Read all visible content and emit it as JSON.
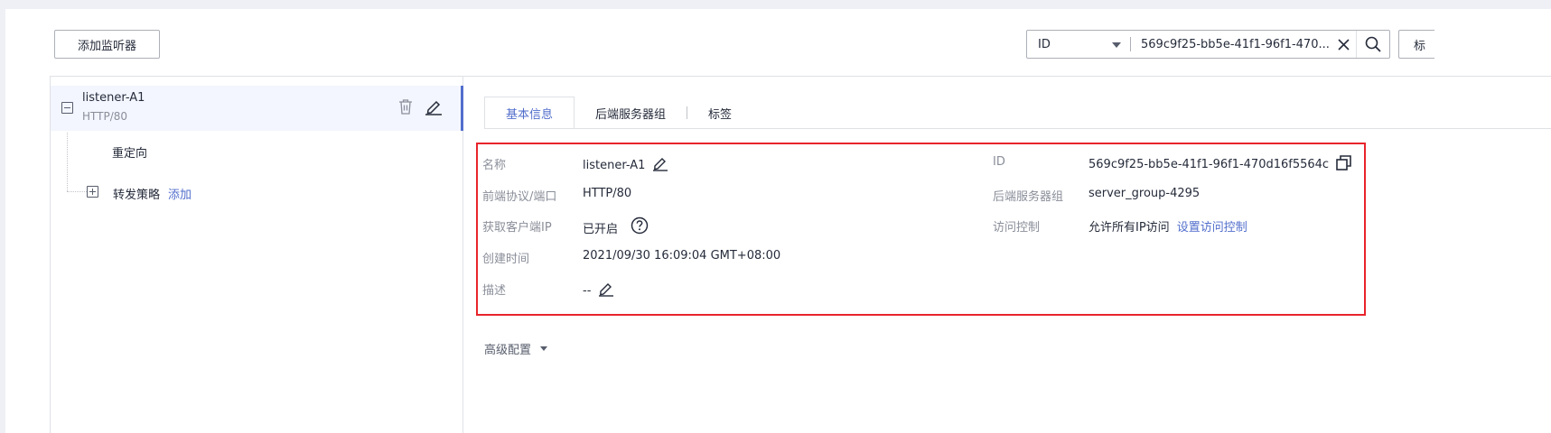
{
  "toolbar": {
    "add_listener_label": "添加监听器",
    "search": {
      "field": "ID",
      "value": "569c9f25-bb5e-41f1-96f1-470...",
      "extra_button_label": "标"
    }
  },
  "tree": {
    "listener": {
      "name": "listener-A1",
      "protocol": "HTTP/80"
    },
    "redirect_label": "重定向",
    "forward_policy_label": "转发策略",
    "forward_policy_add": "添加"
  },
  "tabs": [
    {
      "label": "基本信息",
      "active": true
    },
    {
      "label": "后端服务器组",
      "active": false
    },
    {
      "label": "标签",
      "active": false
    }
  ],
  "basic_info": {
    "name": {
      "label": "名称",
      "value": "listener-A1"
    },
    "frontend": {
      "label": "前端协议/端口",
      "value": "HTTP/80"
    },
    "client_ip": {
      "label": "获取客户端IP",
      "value": "已开启"
    },
    "created": {
      "label": "创建时间",
      "value": "2021/09/30 16:09:04 GMT+08:00"
    },
    "description": {
      "label": "描述",
      "value": "--"
    },
    "id": {
      "label": "ID",
      "value": "569c9f25-bb5e-41f1-96f1-470d16f5564c"
    },
    "backend_group": {
      "label": "后端服务器组",
      "value": "server_group-4295"
    },
    "access_control": {
      "label": "访问控制",
      "value": "允许所有IP访问",
      "link": "设置访问控制"
    }
  },
  "advanced_label": "高级配置",
  "colors": {
    "accent": "#526ecc",
    "highlight_border": "#e8242b"
  }
}
